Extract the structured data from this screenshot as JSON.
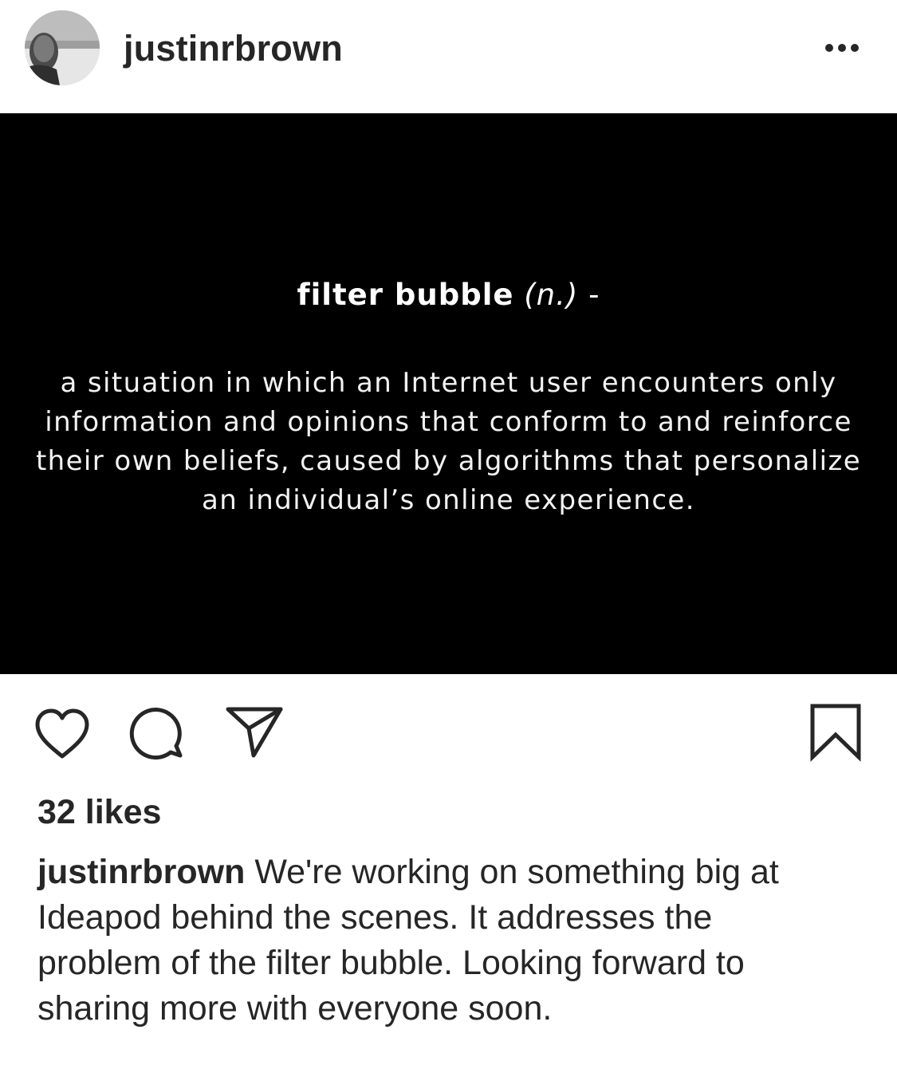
{
  "post": {
    "username": "justinrbrown",
    "avatar_icon": "profile-photo",
    "more_icon": "more-options-icon"
  },
  "image": {
    "term": "filter bubble",
    "part_of_speech": "(n.)",
    "dash": "-",
    "definition": "a situation in which an Internet user encounters only information and opinions that conform to and reinforce their own beliefs, caused by algorithms that personalize an individual’s online experience.",
    "background_color": "#000000",
    "text_color": "#ffffff"
  },
  "actions": {
    "like_icon": "heart-icon",
    "comment_icon": "comment-icon",
    "share_icon": "send-icon",
    "save_icon": "bookmark-icon"
  },
  "likes": {
    "label": "32 likes",
    "count": 32
  },
  "caption": {
    "username": "justinrbrown",
    "text": " We're working on something big at Ideapod behind the scenes. It addresses the problem of the filter bubble. Looking forward to sharing more with everyone soon."
  }
}
